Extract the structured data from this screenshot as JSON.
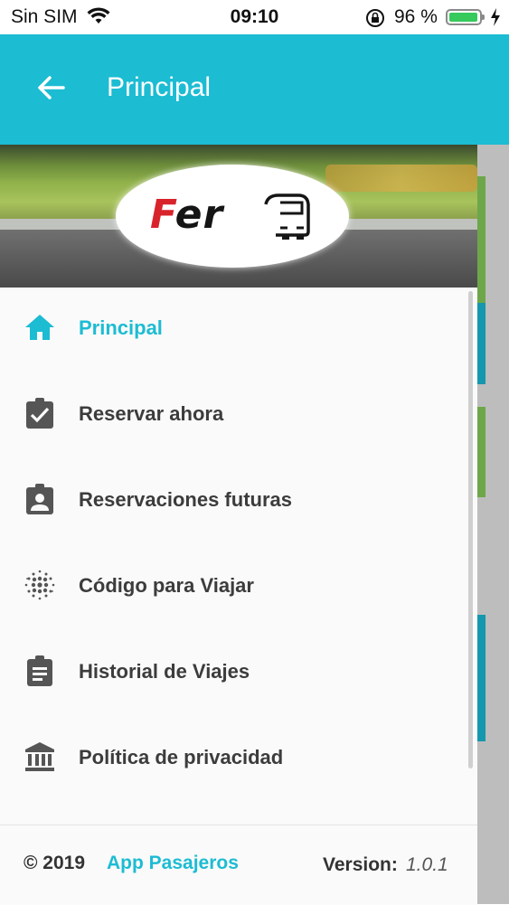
{
  "status_bar": {
    "carrier": "Sin SIM",
    "time": "09:10",
    "battery_percent": "96 %",
    "battery_level": 0.96,
    "battery_color": "#36c95b"
  },
  "app_bar": {
    "title": "Principal",
    "back_icon": "arrow-left-icon",
    "color": "#1cbcd3"
  },
  "drawer": {
    "logo": "Fer",
    "menu": [
      {
        "label": "Principal",
        "icon": "home-icon",
        "active": true
      },
      {
        "label": "Reservar ahora",
        "icon": "clipboard-check-icon",
        "active": false
      },
      {
        "label": "Reservaciones futuras",
        "icon": "contact-badge-icon",
        "active": false
      },
      {
        "label": "Código para Viajar",
        "icon": "dot-grid-icon",
        "active": false
      },
      {
        "label": "Historial de Viajes",
        "icon": "clipboard-text-icon",
        "active": false
      },
      {
        "label": "Política de privacidad",
        "icon": "bank-icon",
        "active": false
      }
    ],
    "footer": {
      "copyright": "© 2019",
      "app_name": "App Pasajeros",
      "version_label": "Version:",
      "version": "1.0.1"
    }
  },
  "colors": {
    "accent": "#1cbcd3",
    "text": "#3c3c3c",
    "icon": "#555555"
  }
}
